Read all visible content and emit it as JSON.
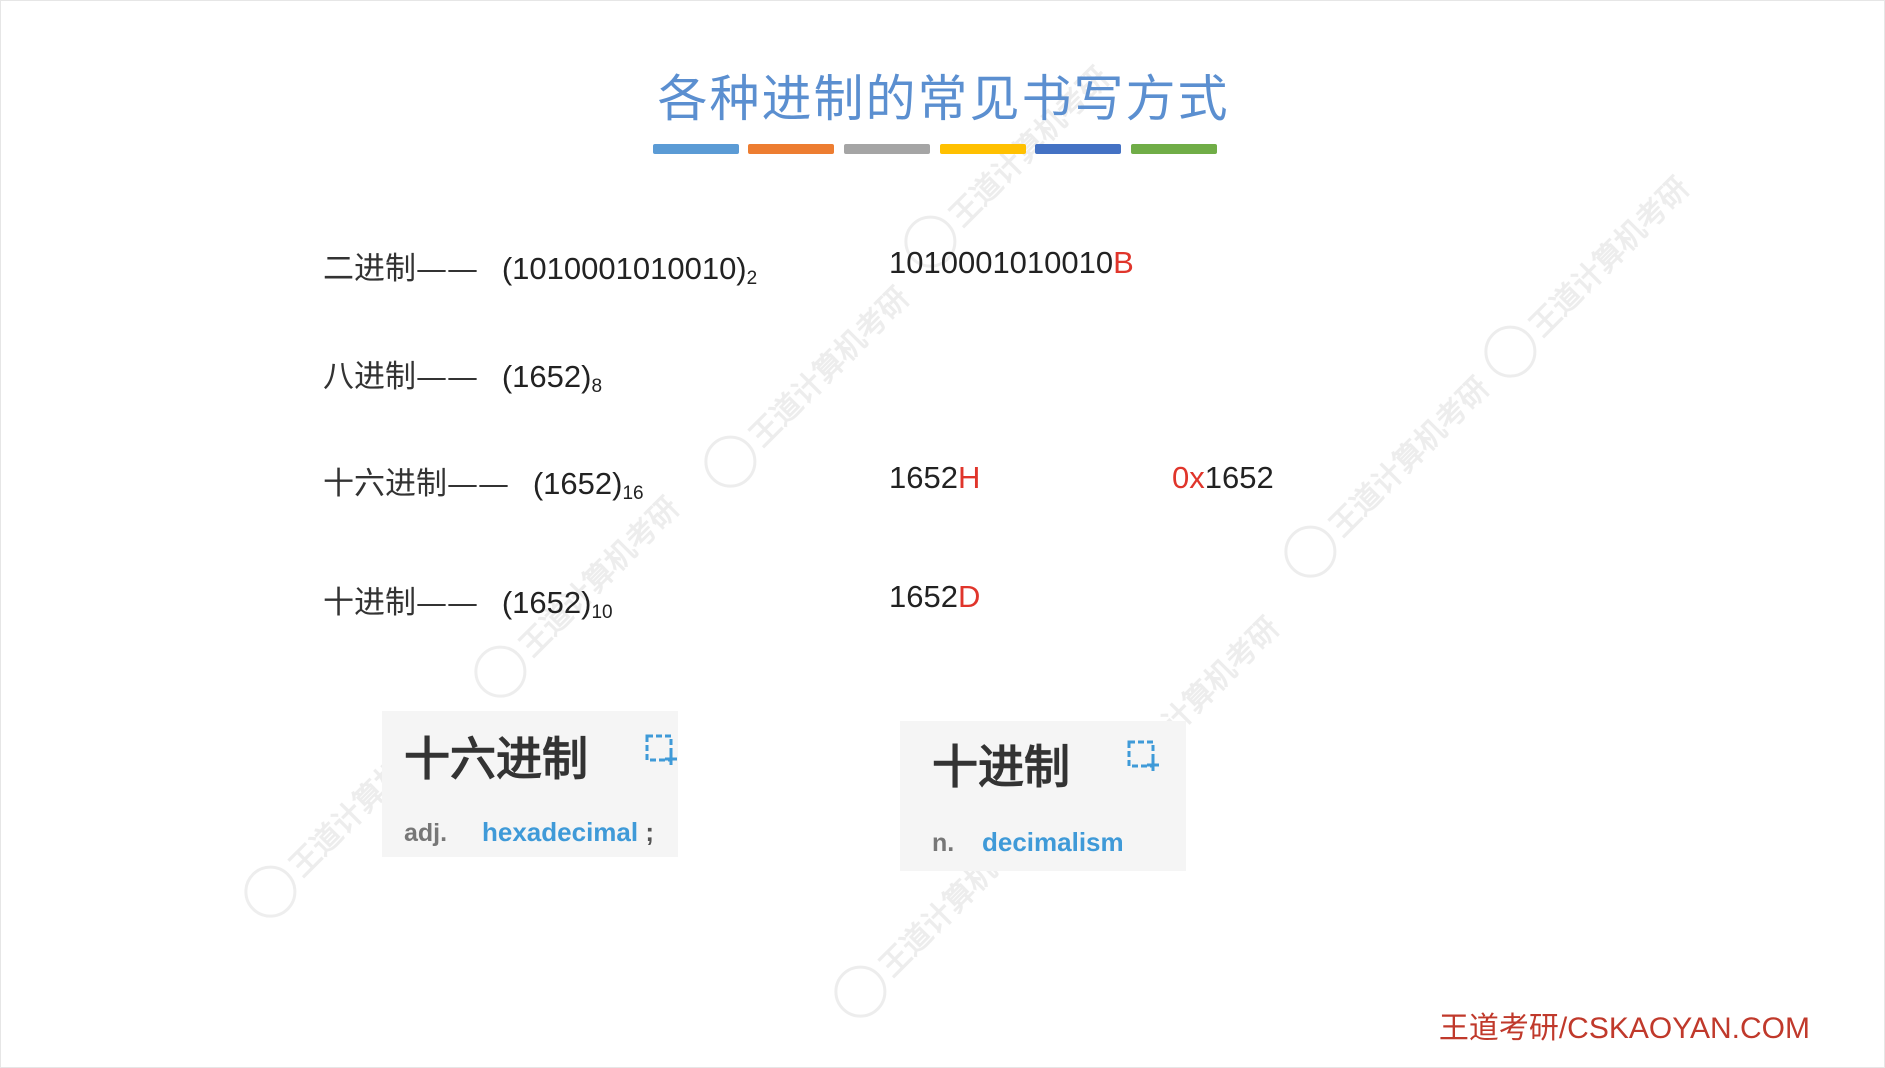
{
  "title": "各种进制的常见书写方式",
  "accent_colors": [
    "#5b9bd5",
    "#ed7d31",
    "#a5a5a5",
    "#ffc000",
    "#4472c4",
    "#70ad47"
  ],
  "rows": [
    {
      "label": "二进制——",
      "value": "(1010001010010)",
      "base": "2",
      "alt1_value": "1010001010010",
      "alt1_suffix": "B"
    },
    {
      "label": "八进制——",
      "value": "(1652)",
      "base": "8"
    },
    {
      "label": "十六进制——",
      "value": "(1652)",
      "base": "16",
      "alt1_value": "1652",
      "alt1_suffix": "H",
      "alt2_prefix": "0x",
      "alt2_value": "1652"
    },
    {
      "label": "十进制——",
      "value": "(1652)",
      "base": "10",
      "alt1_value": "1652",
      "alt1_suffix": "D"
    }
  ],
  "dict_cards": [
    {
      "word": "十六进制",
      "pos": "adj.",
      "definition": "hexadecimal",
      "trail": ";"
    },
    {
      "word": "十进制",
      "pos": "n.",
      "definition": "decimalism"
    }
  ],
  "icons": {
    "add_to_wordbook": "add-to-wordbook-icon",
    "watermark_logo": "wangdao-logo-icon"
  },
  "footer": "王道考研/CSKAOYAN.COM",
  "watermark_text": "王道计算机考研"
}
